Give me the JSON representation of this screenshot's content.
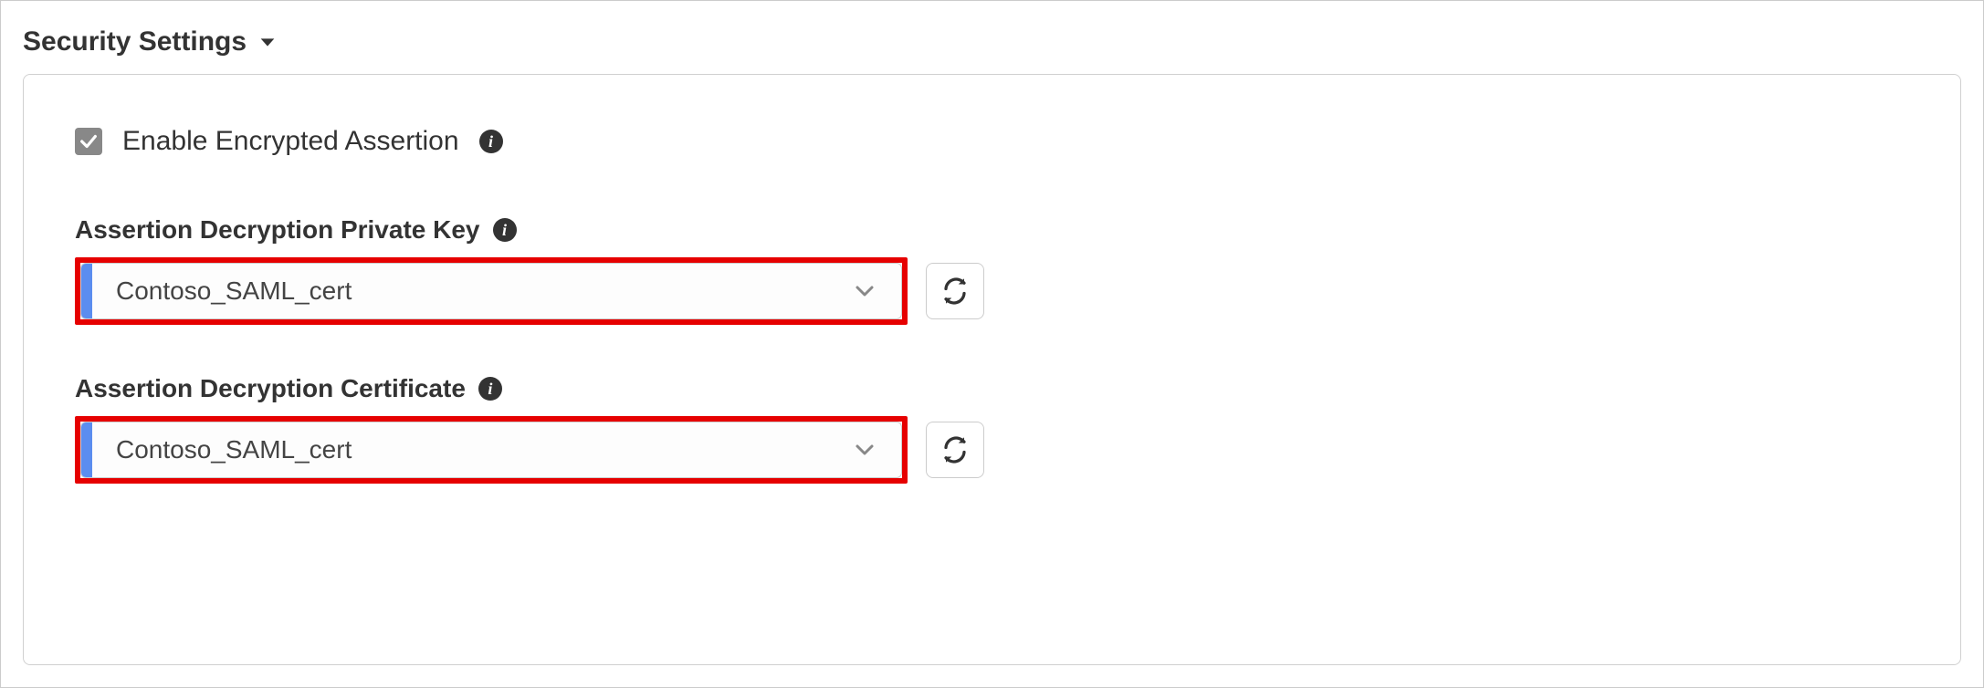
{
  "section": {
    "title": "Security Settings"
  },
  "checkbox": {
    "label": "Enable Encrypted Assertion",
    "checked": true
  },
  "fields": {
    "private_key": {
      "label": "Assertion Decryption Private Key",
      "selected": "Contoso_SAML_cert"
    },
    "certificate": {
      "label": "Assertion Decryption Certificate",
      "selected": "Contoso_SAML_cert"
    }
  },
  "highlight_color": "#e60000",
  "accent_color": "#5b8def"
}
